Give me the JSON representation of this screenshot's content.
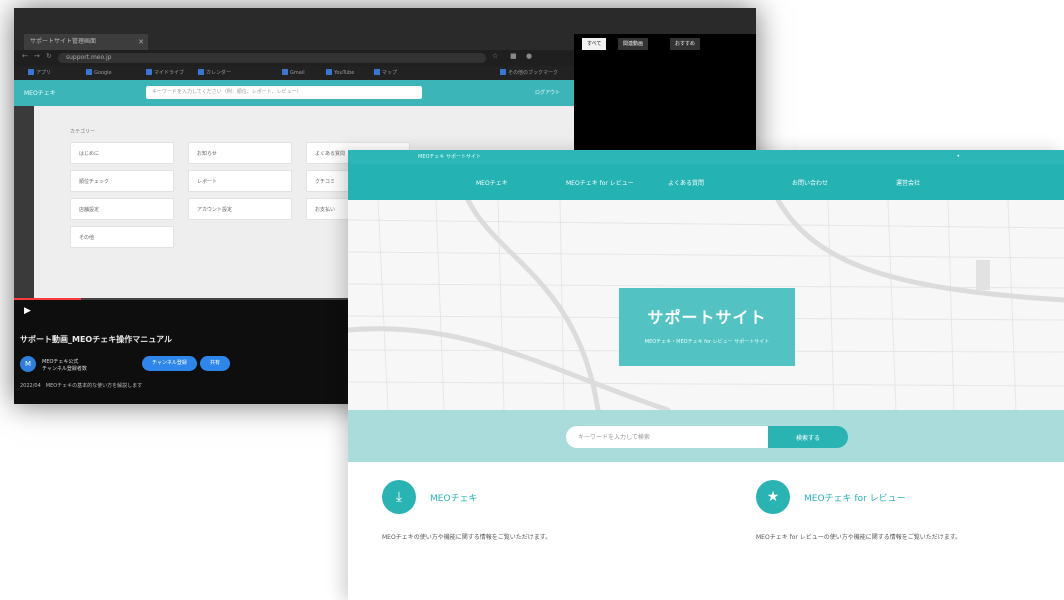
{
  "back_window": {
    "tab_label": "サポートサイト管理画面",
    "url": "support.meo.jp",
    "bookmarks": [
      "アプリ",
      "Google",
      "マイドライブ",
      "カレンダー",
      "Gmail",
      "YouTube",
      "マップ",
      "その他のブックマーク"
    ],
    "app_logo": "MEOチェキ",
    "app_search_placeholder": "キーワードを入力してください（例：順位、レポート、レビュー）",
    "app_user": "ログアウト",
    "section_label": "カテゴリー",
    "cards": [
      "はじめに",
      "お知らせ",
      "よくある質問",
      "順位チェック",
      "レポート",
      "クチコミ",
      "店舗設定",
      "アカウント設定",
      "お支払い",
      "その他"
    ],
    "video_title": "サポート動画_MEOチェキ操作マニュアル",
    "channel_name": "MEOチェキ公式",
    "channel_subs": "チャンネル登録者数",
    "subscribe_label": "チャンネル登録",
    "share_label": "共有",
    "description": "2022/04　MEOチェキの基本的な使い方を解説します",
    "side_buttons": [
      "すべて",
      "関連動画",
      "おすすめ"
    ]
  },
  "front_window": {
    "topbar_text": "MEOチェキ サポートサイト",
    "nav": [
      "MEOチェキ",
      "MEOチェキ for レビュー",
      "よくある質問",
      "お問い合わせ",
      "運営会社"
    ],
    "hero_title": "サポートサイト",
    "hero_subtitle": "MEOチェキ・MEOチェキ for レビュー サポートサイト",
    "search_placeholder": "キーワードを入力して検索",
    "search_button": "検索する",
    "features": [
      {
        "title": "MEOチェキ",
        "icon": "download-icon",
        "desc": "MEOチェキの使い方や機能に関する情報をご覧いただけます。"
      },
      {
        "title": "MEOチェキ for レビュー",
        "icon": "star-icon",
        "desc": "MEOチェキ for レビューの使い方や機能に関する情報をご覧いただけます。"
      }
    ]
  },
  "colors": {
    "accent": "#2ab3b3",
    "hero_box": "#52c3c2",
    "search_band": "#a9dcdb"
  }
}
